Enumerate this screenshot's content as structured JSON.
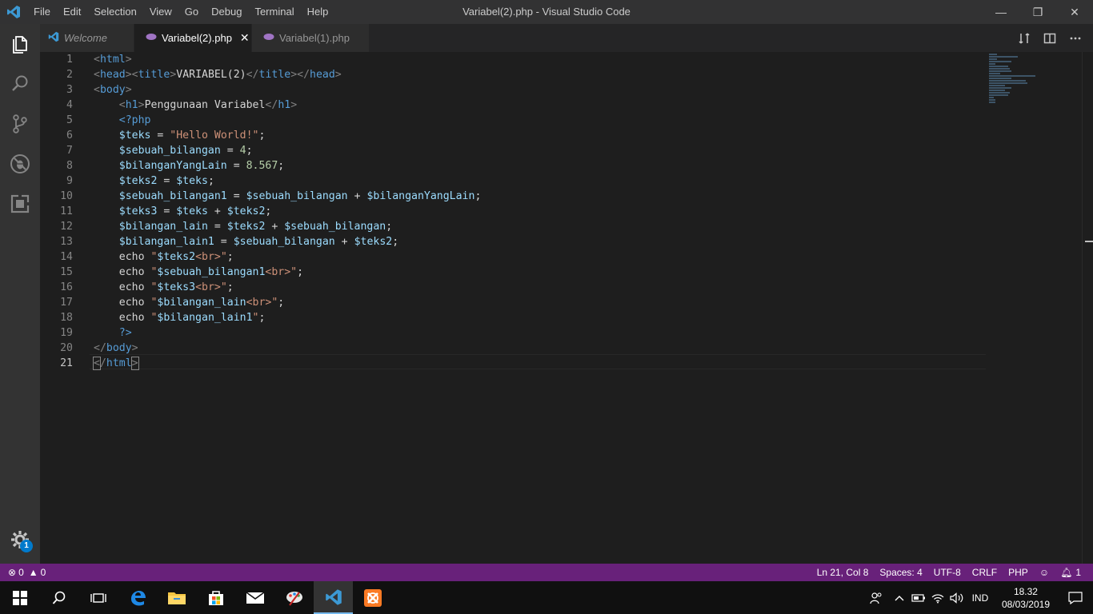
{
  "titlebar": {
    "menu": [
      "File",
      "Edit",
      "Selection",
      "View",
      "Go",
      "Debug",
      "Terminal",
      "Help"
    ],
    "title": "Variabel(2).php - Visual Studio Code",
    "minimize": "—",
    "maximize": "❐",
    "close": "✕"
  },
  "activity": {
    "icons": [
      "files-icon",
      "search-icon",
      "source-control-icon",
      "debug-icon",
      "extensions-icon"
    ],
    "settings_badge": "1"
  },
  "tabs": [
    {
      "label": "Welcome",
      "active": false
    },
    {
      "label": "Variabel(2).php",
      "active": true
    },
    {
      "label": "Variabel(1).php",
      "active": false
    }
  ],
  "editor": {
    "line_numbers": [
      "1",
      "2",
      "3",
      "4",
      "5",
      "6",
      "7",
      "8",
      "9",
      "10",
      "11",
      "12",
      "13",
      "14",
      "15",
      "16",
      "17",
      "18",
      "19",
      "20",
      "21"
    ],
    "current_line": 21
  },
  "statusbar": {
    "errors": "0",
    "warnings": "0",
    "position": "Ln 21, Col 8",
    "spaces": "Spaces: 4",
    "encoding": "UTF-8",
    "eol": "CRLF",
    "language": "PHP",
    "notifications": "1"
  },
  "taskbar": {
    "language": "IND",
    "time": "18.32",
    "date": "08/03/2019"
  },
  "colors": {
    "statusbar": "#68217a",
    "accent": "#007acc"
  }
}
